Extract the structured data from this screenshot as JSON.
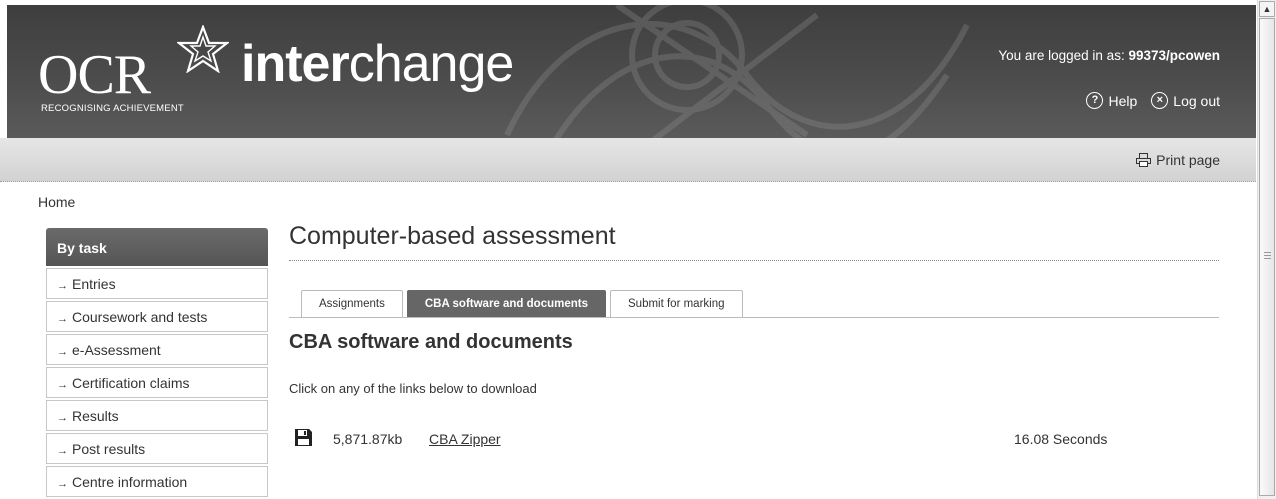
{
  "header": {
    "logo_text": "OCR",
    "tagline": "RECOGNISING ACHIEVEMENT",
    "brand_bold": "inter",
    "brand_light": "change",
    "logged_in_prefix": "You are logged in as: ",
    "username": "99373/pcowen",
    "help_label": "Help",
    "logout_label": "Log out",
    "help_icon": "help-circle-icon",
    "logout_icon": "close-circle-icon"
  },
  "toolbar": {
    "print_label": "Print page",
    "print_icon": "printer-icon"
  },
  "breadcrumb": "Home",
  "sidebar": {
    "heading": "By task",
    "items": [
      {
        "label": "Entries"
      },
      {
        "label": "Coursework and tests"
      },
      {
        "label": "e-Assessment"
      },
      {
        "label": "Certification claims"
      },
      {
        "label": "Results"
      },
      {
        "label": "Post results"
      },
      {
        "label": "Centre information"
      }
    ]
  },
  "main": {
    "title": "Computer-based assessment",
    "tabs": [
      {
        "label": "Assignments",
        "active": false
      },
      {
        "label": "CBA software and documents",
        "active": true
      },
      {
        "label": "Submit for marking",
        "active": false
      }
    ],
    "section_title": "CBA software and documents",
    "intro": "Click on any of the links below to download",
    "files": [
      {
        "icon": "floppy-disk-icon",
        "size": "5,871.87kb",
        "name": "CBA Zipper",
        "time": "16.08 Seconds"
      }
    ]
  },
  "colors": {
    "header_bg": "#474747",
    "toolbar_bg": "#dcdcdc",
    "active_tab": "#666666",
    "sidebar_heading": "#5f5f5f"
  }
}
